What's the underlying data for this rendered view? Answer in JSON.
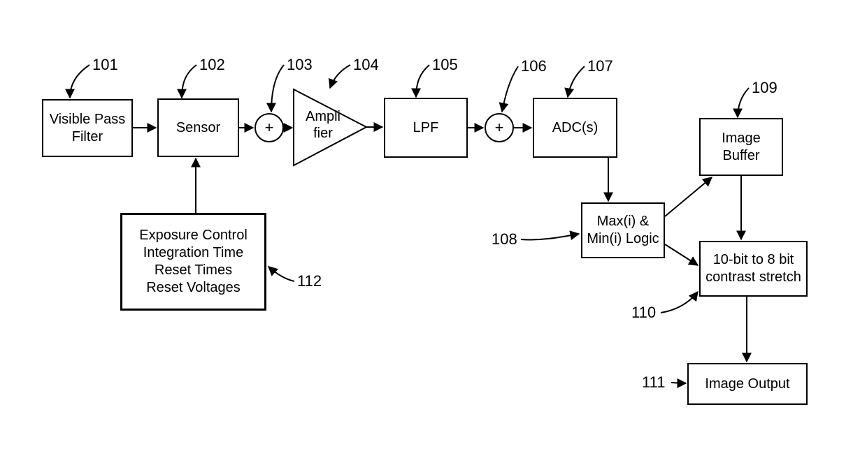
{
  "labels": {
    "n101": "101",
    "n102": "102",
    "n103": "103",
    "n104": "104",
    "n105": "105",
    "n106": "106",
    "n107": "107",
    "n108": "108",
    "n109": "109",
    "n110": "110",
    "n111": "111",
    "n112": "112"
  },
  "blocks": {
    "b101": "Visible Pass\nFilter",
    "b102": "Sensor",
    "b104": "Ampli\nfier",
    "b105": "LPF",
    "b107": "ADC(s)",
    "b108": "Max(i) &\nMin(i) Logic",
    "b109": "Image\nBuffer",
    "b110": "10-bit to 8 bit\ncontrast stretch",
    "b111": "Image Output",
    "b112": "Exposure Control\nIntegration Time\nReset Times\nReset Voltages"
  },
  "summers": {
    "s103": "+",
    "s106": "+"
  }
}
